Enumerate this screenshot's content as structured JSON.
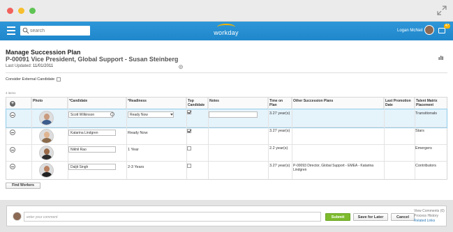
{
  "window": {},
  "header": {
    "search_placeholder": "search",
    "logo": "workday",
    "user_name": "Logan McNeil",
    "inbox_count": "47"
  },
  "page": {
    "title": "Manage Succession Plan",
    "subtitle": "P-00091 Vice President, Global Support - Susan Steinberg",
    "last_updated_label": "Last Updated:",
    "last_updated_value": "11/01/2011",
    "external_label": "Consider External Candidate",
    "items_count": "4 items"
  },
  "grid": {
    "columns": {
      "photo": "Photo",
      "candidate": "*Candidate",
      "readiness": "*Readiness",
      "top_candidate": "Top Candidate",
      "notes": "Notes",
      "time_on_plan": "Time on Plan",
      "other_plans": "Other Succession Plans",
      "last_promotion": "Last Promotion Date",
      "talent_matrix": "Talent Matrix Placement"
    },
    "rows": [
      {
        "candidate": "Scott Wilkinson",
        "readiness": "Ready Now",
        "top": true,
        "time": "3.27 year(s)",
        "other": "",
        "matrix": "Transitionals"
      },
      {
        "candidate": "Katarina Lindgren",
        "readiness": "Ready Now",
        "top": true,
        "time": "3.27 year(s)",
        "other": "",
        "matrix": "Stars"
      },
      {
        "candidate": "Nikhil Rao",
        "readiness": "1 Year",
        "top": false,
        "time": "2.2 year(s)",
        "other": "",
        "matrix": "Emergers"
      },
      {
        "candidate": "Daljit Singh",
        "readiness": "2-3 Years",
        "top": false,
        "time": "3.27 year(s)",
        "other": "P-00093 Director, Global Support - EMEA - Katarina Lindgren",
        "matrix": "Contributors"
      }
    ]
  },
  "actions": {
    "find_workers": "Find Workers",
    "comment_placeholder": "enter your comment",
    "submit": "Submit",
    "save_for_later": "Save for Later",
    "cancel": "Cancel",
    "view_comments": "View Comments (0)",
    "process_history": "Process History",
    "related_links": "Related Links"
  },
  "colors": {
    "header_blue": "#2e97d8",
    "submit_green": "#7dbb2d",
    "selected_row": "#e5f3fb"
  }
}
